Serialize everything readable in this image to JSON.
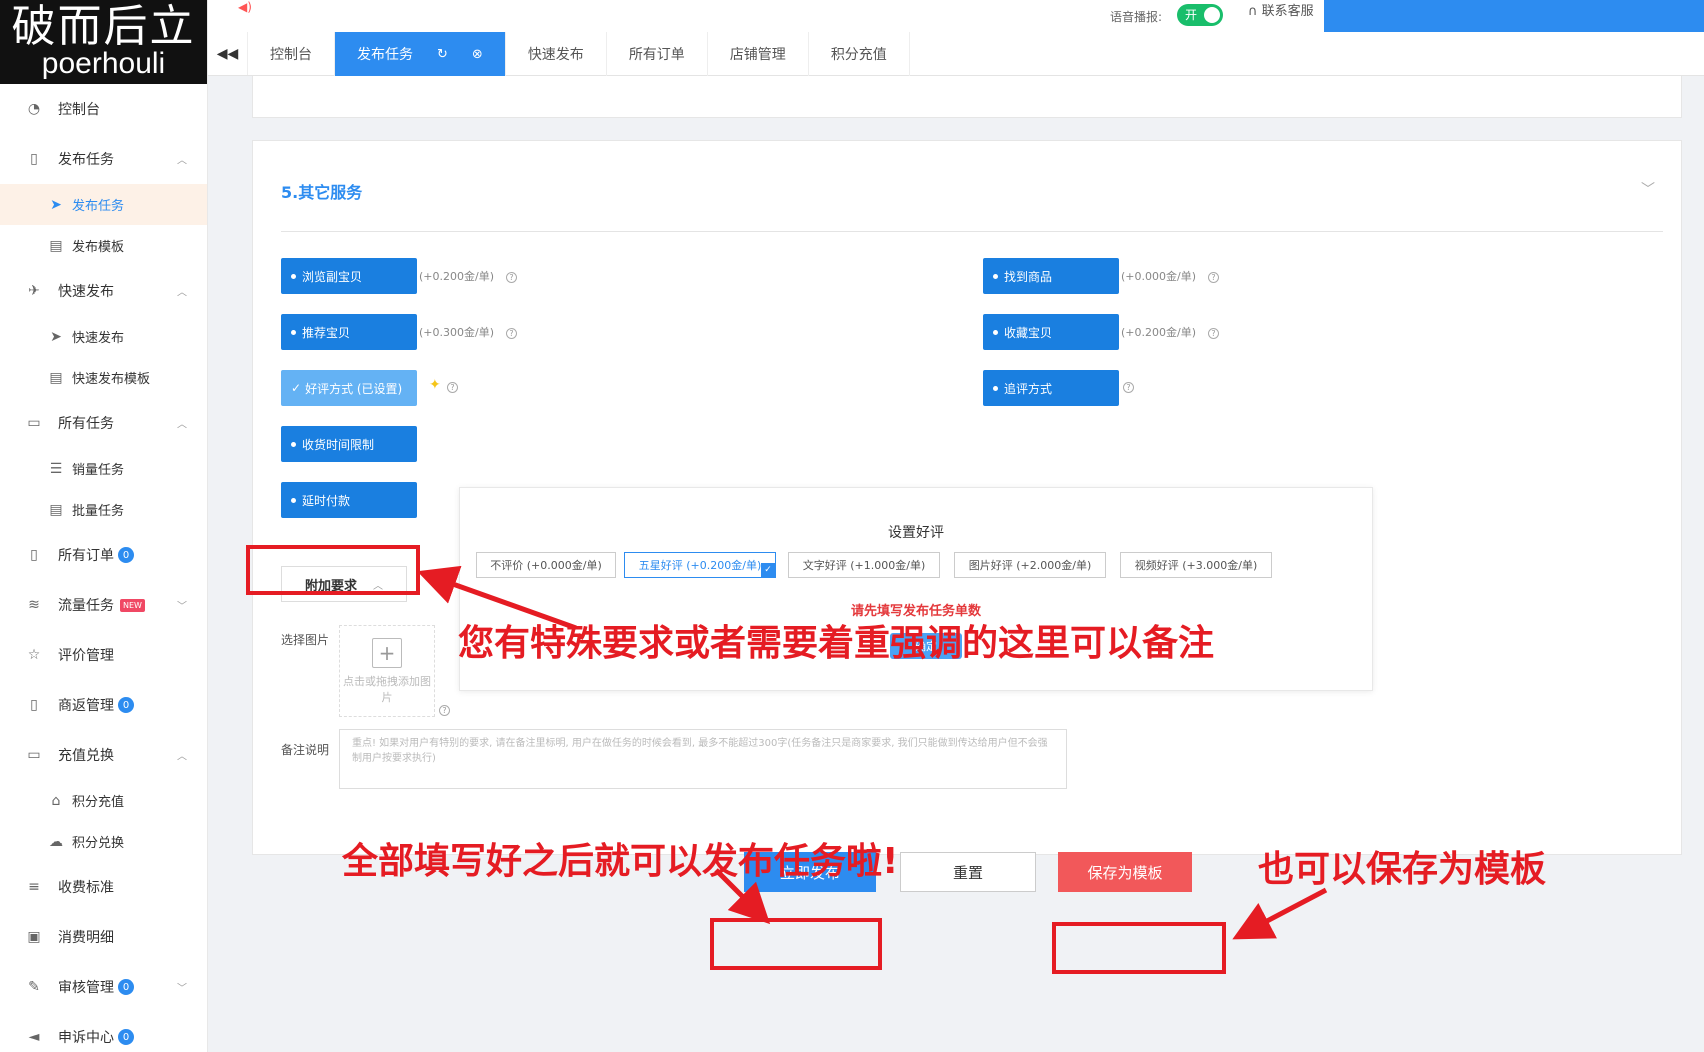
{
  "logo": {
    "zh": "破而后立",
    "en": "poerhouli"
  },
  "topbar": {
    "voice_label": "语音播报:",
    "voice_toggle": "开",
    "support": "联系客服"
  },
  "tabs": [
    {
      "label": "控制台"
    },
    {
      "label": "发布任务",
      "active": true
    },
    {
      "label": "快速发布"
    },
    {
      "label": "所有订单"
    },
    {
      "label": "店铺管理"
    },
    {
      "label": "积分充值"
    }
  ],
  "sidebar": {
    "items": [
      {
        "label": "控制台",
        "icon": "dashboard-icon"
      },
      {
        "label": "发布任务",
        "icon": "file-plus-icon"
      },
      {
        "label": "发布任务",
        "icon": "paper-plane-icon"
      },
      {
        "label": "发布模板",
        "icon": "template-icon"
      },
      {
        "label": "快速发布",
        "icon": "airplane-icon"
      },
      {
        "label": "快速发布",
        "icon": "paper-plane-icon"
      },
      {
        "label": "快速发布模板",
        "icon": "template-icon"
      },
      {
        "label": "所有任务",
        "icon": "list-icon"
      },
      {
        "label": "销量任务",
        "icon": "list-icon"
      },
      {
        "label": "批量任务",
        "icon": "list-icon"
      },
      {
        "label": "所有订单",
        "icon": "order-icon",
        "badge": "0"
      },
      {
        "label": "流量任务",
        "icon": "traffic-icon",
        "new": "NEW"
      },
      {
        "label": "评价管理",
        "icon": "star-icon"
      },
      {
        "label": "商返管理",
        "icon": "return-icon",
        "badge": "0"
      },
      {
        "label": "充值兑换",
        "icon": "card-icon"
      },
      {
        "label": "积分充值",
        "icon": "coins-icon"
      },
      {
        "label": "积分兑换",
        "icon": "cloud-icon"
      },
      {
        "label": "收费标准",
        "icon": "database-icon"
      },
      {
        "label": "消费明细",
        "icon": "receipt-icon"
      },
      {
        "label": "审核管理",
        "icon": "edit-icon",
        "badge": "0"
      },
      {
        "label": "申诉中心",
        "icon": "megaphone-icon",
        "badge": "0"
      }
    ]
  },
  "section": {
    "title": "5.其它服务"
  },
  "services": {
    "browse": {
      "label": "浏览副宝贝",
      "price": "(+0.200金/单)"
    },
    "find": {
      "label": "找到商品",
      "price": "(+0.000金/单)"
    },
    "recommend": {
      "label": "推荐宝贝",
      "price": "(+0.300金/单)"
    },
    "favorite": {
      "label": "收藏宝贝",
      "price": "(+0.200金/单)"
    },
    "review": {
      "label": "好评方式 (已设置)"
    },
    "followup": {
      "label": "追评方式"
    },
    "receipt": {
      "label": "收货时间限制"
    },
    "delay": {
      "label": "延时付款"
    }
  },
  "popup": {
    "title": "设置好评",
    "options": [
      "不评价 (+0.000金/单)",
      "五星好评 (+0.200金/单)",
      "文字好评 (+1.000金/单)",
      "图片好评 (+2.000金/单)",
      "视频好评 (+3.000金/单)"
    ],
    "warning": "请先填写发布任务单数",
    "confirm": "确定"
  },
  "extra": {
    "button": "附加要求",
    "image_label": "选择图片",
    "upload_text": "点击或拖拽添加图片",
    "note_label": "备注说明",
    "note_placeholder": "重点! 如果对用户有特别的要求, 请在备注里标明, 用户在做任务的时候会看到, 最多不能超过300字(任务备注只是商家要求, 我们只能做到传达给用户但不会强制用户按要求执行)"
  },
  "actions": {
    "publish": "立即发布",
    "reset": "重置",
    "save": "保存为模板"
  },
  "annotations": {
    "a1": "您有特殊要求或者需要着重强调的这里可以备注",
    "a2": "全部填写好之后就可以发布任务啦!",
    "a3": "也可以保存为模板"
  },
  "colors": {
    "primary": "#2d8cf0",
    "annotation": "#e51c23",
    "save": "#f2585a"
  }
}
